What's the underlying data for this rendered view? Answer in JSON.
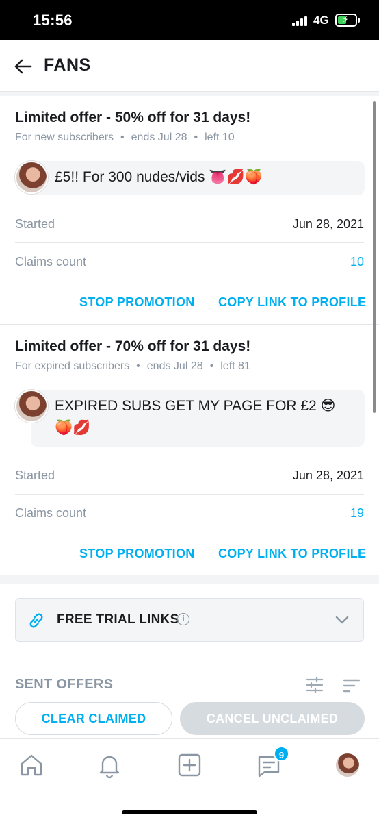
{
  "status_bar": {
    "time": "15:56",
    "network": "4G"
  },
  "header": {
    "title": "FANS"
  },
  "promotions": [
    {
      "title": "Limited offer - 50% off for 31 days!",
      "audience": "For new subscribers",
      "ends": "ends Jul 28",
      "left": "left 10",
      "message": "£5!! For 300 nudes/vids 👅💋🍑",
      "started_label": "Started",
      "started_value": "Jun 28, 2021",
      "claims_label": "Claims count",
      "claims_value": "10",
      "stop_label": "STOP PROMOTION",
      "copy_label": "COPY LINK TO PROFILE"
    },
    {
      "title": "Limited offer - 70% off for 31 days!",
      "audience": "For expired subscribers",
      "ends": "ends Jul 28",
      "left": "left 81",
      "message": "EXPIRED SUBS GET MY PAGE FOR £2 😎🍑💋",
      "started_label": "Started",
      "started_value": "Jun 28, 2021",
      "claims_label": "Claims count",
      "claims_value": "19",
      "stop_label": "STOP PROMOTION",
      "copy_label": "COPY LINK TO PROFILE"
    }
  ],
  "free_trial": {
    "label": "FREE TRIAL LINKS",
    "info_symbol": "i"
  },
  "sent_offers": {
    "label": "SENT OFFERS",
    "clear_label": "CLEAR CLAIMED",
    "cancel_label": "CANCEL UNCLAIMED"
  },
  "bottom_nav": {
    "items": [
      "home-icon",
      "bell-icon",
      "add-post-icon",
      "messages-icon",
      "profile-avatar"
    ],
    "messages_badge": "9"
  },
  "colors": {
    "accent": "#00aff0",
    "muted": "#8a96a3",
    "disabled": "#d6dbe0"
  }
}
